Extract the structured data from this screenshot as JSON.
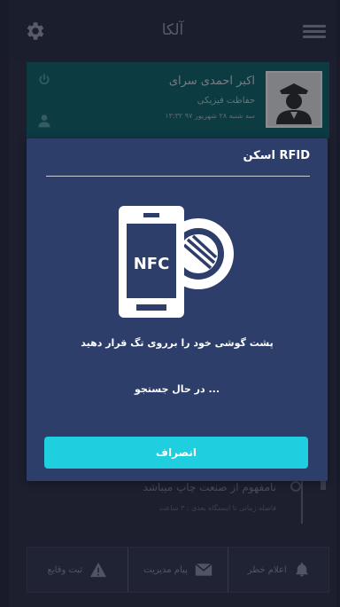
{
  "header": {
    "title": "آلکا",
    "settings_icon": "gear-icon",
    "menu_icon": "hamburger-menu-icon"
  },
  "profile": {
    "name": "اکبر احمدی سرای",
    "role": "حفاظت فیزیکی",
    "date": "سه شنبه ۲۸ شهریور ۹۷ ۱۳:۳۲"
  },
  "list_row": {
    "text": "نامفهوم از صنعت چاپ میباشد",
    "sub": "فاصله زمانی تا ایستگاه بعدی : ۳ ساعت"
  },
  "toolbar": {
    "items": [
      {
        "label": "اعلام خطر",
        "icon": "bell-icon"
      },
      {
        "label": "پیام مدیریت",
        "icon": "envelope-icon"
      },
      {
        "label": "ثبت وقایع",
        "icon": "warning-icon"
      }
    ]
  },
  "dialog": {
    "title": "RFID اسکن",
    "nfc_label": "NFC",
    "instruction": "پشت گوشی خود را برروی تگ قرار دهید",
    "status": "... در حال جستجو",
    "cancel_label": "انصراف"
  },
  "colors": {
    "dialog_bg": "#2d3e6a",
    "accent": "#1fcfe0",
    "profile_bg": "#0f5a5e"
  }
}
